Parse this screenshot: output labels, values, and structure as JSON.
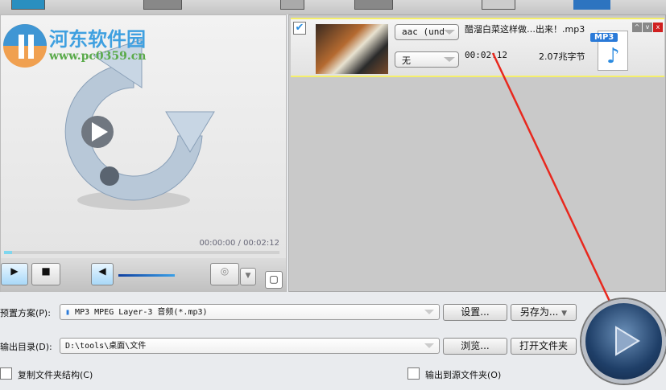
{
  "watermark": {
    "brand": "河东软件园",
    "url": "www.pc0359.cn"
  },
  "player": {
    "time": "00:00:00 / 00:02:12",
    "volume": 0.95,
    "progress": 0.03
  },
  "file": {
    "checked": true,
    "audio_codec": "aac (und",
    "subtitle": "无",
    "name": "醋溜白菜这样做…出来！.mp3",
    "duration": "00:02:12",
    "size": "2.07兆字节",
    "badge": "MP3"
  },
  "row_controls": {
    "up": "^",
    "down": "v",
    "close": "x"
  },
  "bottom": {
    "preset_label": "预置方案(P):",
    "preset_value": "MP3 MPEG Layer-3 音频(*.mp3)",
    "settings_button": "设置...",
    "save_as_button": "另存为...",
    "output_label": "输出目录(D):",
    "output_value": "D:\\tools\\桌面\\文件",
    "browse_button": "浏览...",
    "open_folder_button": "打开文件夹",
    "copy_structure": "复制文件夹结构(C)",
    "output_to_source": "输出到源文件夹(O)"
  },
  "colors": {
    "accent": "#3fa0e0",
    "arrow": "#e8281e"
  }
}
